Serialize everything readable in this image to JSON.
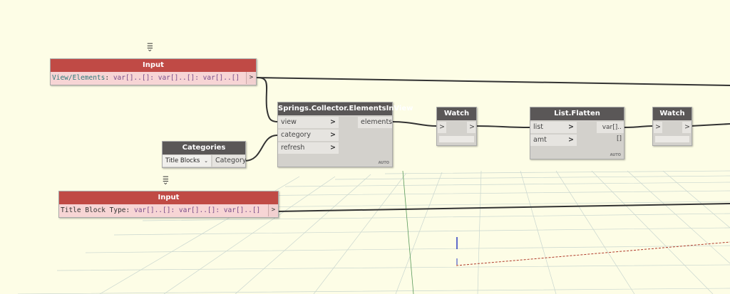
{
  "input1": {
    "title": "Input",
    "label": "View/Elements",
    "sep": ": ",
    "type": "var[]..[]: var[]..[]: var[]..[]",
    "out": ">"
  },
  "input2": {
    "title": "Input",
    "label": "Title Block Type",
    "sep": ": ",
    "type": "var[]..[]: var[]..[]: var[]..[]",
    "out": ">"
  },
  "springs": {
    "title": "Springs.Collector.ElementsInView",
    "inputs": [
      "view",
      "category",
      "refresh"
    ],
    "output": "elements",
    "lacing": "AUTO"
  },
  "categories": {
    "title": "Categories",
    "selected": "Title Blocks",
    "output": "Category"
  },
  "watch1": {
    "title": "Watch",
    "in": ">",
    "out": ">"
  },
  "watch2": {
    "title": "Watch",
    "in": ">",
    "out": ">"
  },
  "flatten": {
    "title": "List.Flatten",
    "inputs": [
      "list",
      "amt"
    ],
    "output": "var[]..[]",
    "lacing": "AUTO"
  },
  "chev": ">"
}
